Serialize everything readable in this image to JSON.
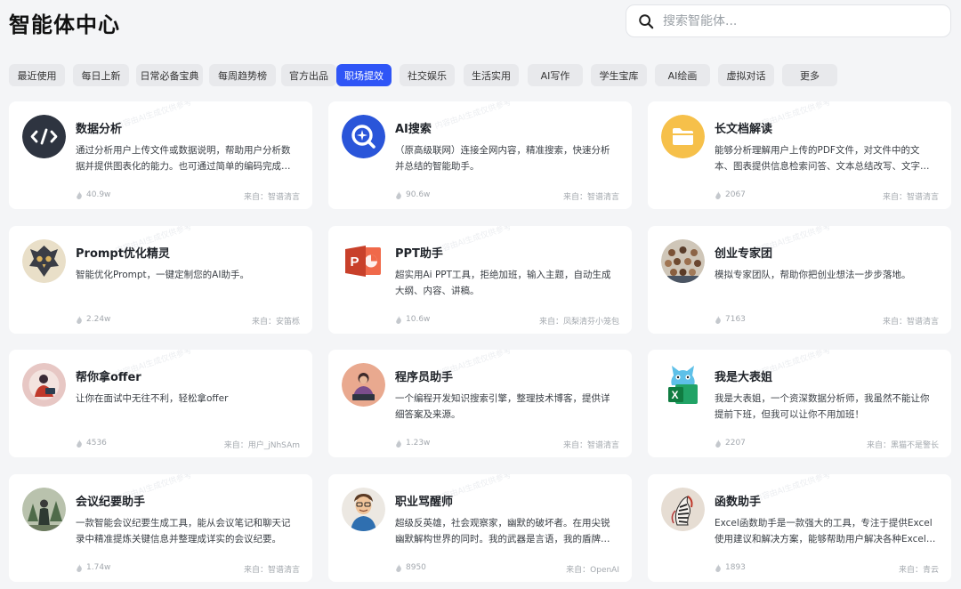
{
  "title": "智能体中心",
  "search": {
    "placeholder": "搜索智能体..."
  },
  "tabs": [
    {
      "label": "最近使用",
      "active": false
    },
    {
      "label": "每日上新",
      "active": false
    },
    {
      "label": "日常必备宝典",
      "active": false
    },
    {
      "label": "每周趋势榜",
      "active": false
    },
    {
      "label": "官方出品",
      "active": false
    },
    {
      "label": "职场提效",
      "active": true
    },
    {
      "label": "社交娱乐",
      "active": false
    },
    {
      "label": "生活实用",
      "active": false
    },
    {
      "label": "AI写作",
      "active": false
    },
    {
      "label": "学生宝库",
      "active": false
    },
    {
      "label": "AI绘画",
      "active": false
    },
    {
      "label": "虚拟对话",
      "active": false
    },
    {
      "label": "更多",
      "active": false
    }
  ],
  "cards": [
    {
      "name": "数据分析",
      "desc": "通过分析用户上传文件或数据说明，帮助用户分析数据并提供图表化的能力。也可通过简单的编码完成文件处理等工作。",
      "count": "40.9w",
      "source": "来自：智谱清言",
      "icon": "code-icon"
    },
    {
      "name": "AI搜索",
      "desc": "（原高级联网）连接全网内容，精准搜索，快速分析并总结的智能助手。",
      "count": "90.6w",
      "source": "来自：智谱清言",
      "icon": "search-sparkle-icon"
    },
    {
      "name": "长文档解读",
      "desc": "能够分析理解用户上传的PDF文件，对文件中的文本、图表提供信息检索问答、文本总结改写、文字翻译等能力。",
      "count": "2067",
      "source": "来自：智谱清言",
      "icon": "folder-icon"
    },
    {
      "name": "Prompt优化精灵",
      "desc": "智能优化Prompt，一键定制您的AI助手。",
      "count": "2.24w",
      "source": "来自：安笛栎",
      "icon": "owl-emblem-icon"
    },
    {
      "name": "PPT助手",
      "desc": "超实用Ai PPT工具，拒绝加班，输入主题，自动生成大纲、内容、讲稿。",
      "count": "10.6w",
      "source": "来自：凤梨清芬小笼包",
      "icon": "powerpoint-icon"
    },
    {
      "name": "创业专家团",
      "desc": "模拟专家团队，帮助你把创业想法一步步落地。",
      "count": "7163",
      "source": "来自：智谱清言",
      "icon": "team-crowd-icon"
    },
    {
      "name": "帮你拿offer",
      "desc": "让你在面试中无往不利，轻松拿offer",
      "count": "4536",
      "source": "来自：用户_jNhSAm",
      "icon": "interview-person-icon"
    },
    {
      "name": "程序员助手",
      "desc": "一个编程开发知识搜索引擎，整理技术博客，提供详细答案及来源。",
      "count": "1.23w",
      "source": "来自：智谱清言",
      "icon": "programmer-icon"
    },
    {
      "name": "我是大表姐",
      "desc": "我是大表姐，一个资深数据分析师，我虽然不能让你提前下班，但我可以让你不用加班！",
      "count": "2207",
      "source": "来自：黑猫不是警长",
      "icon": "excel-cat-icon"
    },
    {
      "name": "会议纪要助手",
      "desc": "一款智能会议纪要生成工具，能从会议笔记和聊天记录中精准提炼关键信息并整理成详实的会议纪要。",
      "count": "1.74w",
      "source": "来自：智谱清言",
      "icon": "forest-figure-icon"
    },
    {
      "name": "职业骂醒师",
      "desc": "超级反英雄，社会观察家，幽默的破坏者。在用尖锐幽默解构世界的同时。我的武器是言语，我的盾牌是真实。",
      "count": "8950",
      "source": "来自：OpenAI",
      "icon": "cartoon-man-icon"
    },
    {
      "name": "函数助手",
      "desc": "Excel函数助手是一款强大的工具，专注于提供Excel使用建议和解决方案，能够帮助用户解决各种Excel问题。",
      "count": "1893",
      "source": "来自：青云",
      "icon": "zebra-art-icon"
    }
  ],
  "watermark": "内容由AI生成仅供参考"
}
